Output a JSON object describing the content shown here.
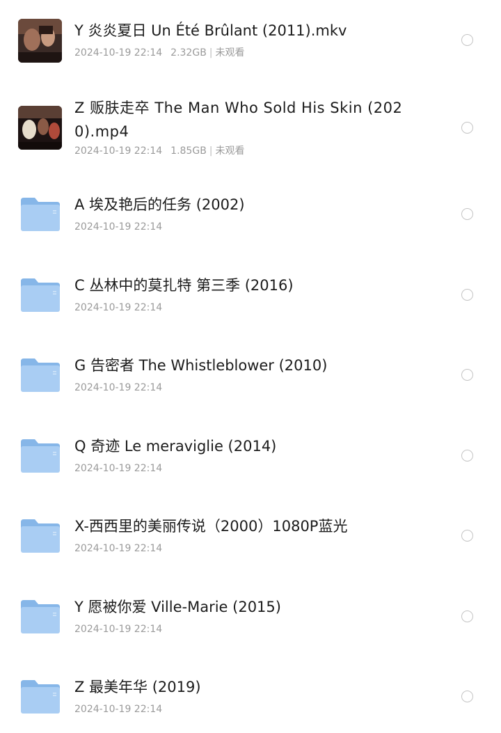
{
  "colors": {
    "folder_light": "#a9cdf3",
    "folder_dark": "#86b6e8",
    "meta_text": "#9a9a9a",
    "radio_border": "#c4c4c4"
  },
  "items": [
    {
      "type": "video",
      "icon": "video-thumbnail",
      "name": "Y 炎炎夏日 Un Été Brûlant (2011).mkv",
      "date": "2024-10-19 22:14",
      "size": "2.32GB",
      "separator": "|",
      "status": "未观看",
      "selected": false
    },
    {
      "type": "video",
      "icon": "video-thumbnail",
      "name": "Z 贩肤走卒 The Man Who Sold His Skin (2020).mp4",
      "date": "2024-10-19 22:14",
      "size": "1.85GB",
      "separator": "|",
      "status": "未观看",
      "selected": false
    },
    {
      "type": "folder",
      "icon": "folder-icon",
      "name": "A 埃及艳后的任务 (2002)",
      "date": "2024-10-19 22:14",
      "selected": false
    },
    {
      "type": "folder",
      "icon": "folder-icon",
      "name": "C 丛林中的莫扎特 第三季 (2016)",
      "date": "2024-10-19 22:14",
      "selected": false
    },
    {
      "type": "folder",
      "icon": "folder-icon",
      "name": "G 告密者 The Whistleblower (2010)",
      "date": "2024-10-19 22:14",
      "selected": false
    },
    {
      "type": "folder",
      "icon": "folder-icon",
      "name": "Q 奇迹 Le meraviglie (2014)",
      "date": "2024-10-19 22:14",
      "selected": false
    },
    {
      "type": "folder",
      "icon": "folder-icon",
      "name": "X-西西里的美丽传说（2000）1080P蓝光",
      "date": "2024-10-19 22:14",
      "selected": false
    },
    {
      "type": "folder",
      "icon": "folder-icon",
      "name": "Y 愿被你爱 Ville-Marie (2015)",
      "date": "2024-10-19 22:14",
      "selected": false
    },
    {
      "type": "folder",
      "icon": "folder-icon",
      "name": "Z 最美年华 (2019)",
      "date": "2024-10-19 22:14",
      "selected": false
    }
  ]
}
